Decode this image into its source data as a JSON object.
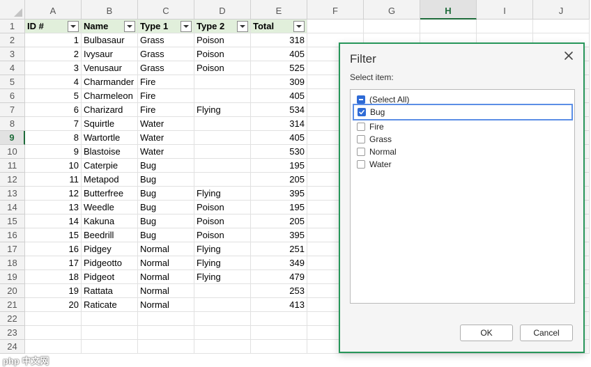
{
  "spreadsheet": {
    "columns": [
      "A",
      "B",
      "C",
      "D",
      "E",
      "F",
      "G",
      "H",
      "I",
      "J"
    ],
    "selected_column": "H",
    "selected_row": 9,
    "row_numbers": [
      1,
      2,
      3,
      4,
      5,
      6,
      7,
      8,
      9,
      10,
      11,
      12,
      13,
      14,
      15,
      16,
      17,
      18,
      19,
      20,
      21,
      22,
      23,
      24
    ],
    "headers": [
      "ID #",
      "Name",
      "Type 1",
      "Type 2",
      "Total"
    ],
    "rows": [
      [
        "1",
        "Bulbasaur",
        "Grass",
        "Poison",
        "318"
      ],
      [
        "2",
        "Ivysaur",
        "Grass",
        "Poison",
        "405"
      ],
      [
        "3",
        "Venusaur",
        "Grass",
        "Poison",
        "525"
      ],
      [
        "4",
        "Charmander",
        "Fire",
        "",
        "309"
      ],
      [
        "5",
        "Charmeleon",
        "Fire",
        "",
        "405"
      ],
      [
        "6",
        "Charizard",
        "Fire",
        "Flying",
        "534"
      ],
      [
        "7",
        "Squirtle",
        "Water",
        "",
        "314"
      ],
      [
        "8",
        "Wartortle",
        "Water",
        "",
        "405"
      ],
      [
        "9",
        "Blastoise",
        "Water",
        "",
        "530"
      ],
      [
        "10",
        "Caterpie",
        "Bug",
        "",
        "195"
      ],
      [
        "11",
        "Metapod",
        "Bug",
        "",
        "205"
      ],
      [
        "12",
        "Butterfree",
        "Bug",
        "Flying",
        "395"
      ],
      [
        "13",
        "Weedle",
        "Bug",
        "Poison",
        "195"
      ],
      [
        "14",
        "Kakuna",
        "Bug",
        "Poison",
        "205"
      ],
      [
        "15",
        "Beedrill",
        "Bug",
        "Poison",
        "395"
      ],
      [
        "16",
        "Pidgey",
        "Normal",
        "Flying",
        "251"
      ],
      [
        "17",
        "Pidgeotto",
        "Normal",
        "Flying",
        "349"
      ],
      [
        "18",
        "Pidgeot",
        "Normal",
        "Flying",
        "479"
      ],
      [
        "19",
        "Rattata",
        "Normal",
        "",
        "253"
      ],
      [
        "20",
        "Raticate",
        "Normal",
        "",
        "413"
      ]
    ]
  },
  "filter_dialog": {
    "title": "Filter",
    "label": "Select item:",
    "items": [
      {
        "label": "(Select All)",
        "state": "mixed"
      },
      {
        "label": "Bug",
        "state": "checked"
      },
      {
        "label": "Fire",
        "state": "unchecked"
      },
      {
        "label": "Grass",
        "state": "unchecked"
      },
      {
        "label": "Normal",
        "state": "unchecked"
      },
      {
        "label": "Water",
        "state": "unchecked"
      }
    ],
    "ok_label": "OK",
    "cancel_label": "Cancel"
  },
  "watermark": "php 中文网",
  "colors": {
    "accent": "#1e6b3a",
    "header_fill": "#e1efdb",
    "dialog_border": "#27965a",
    "checkbox_blue": "#2f6bd6"
  }
}
